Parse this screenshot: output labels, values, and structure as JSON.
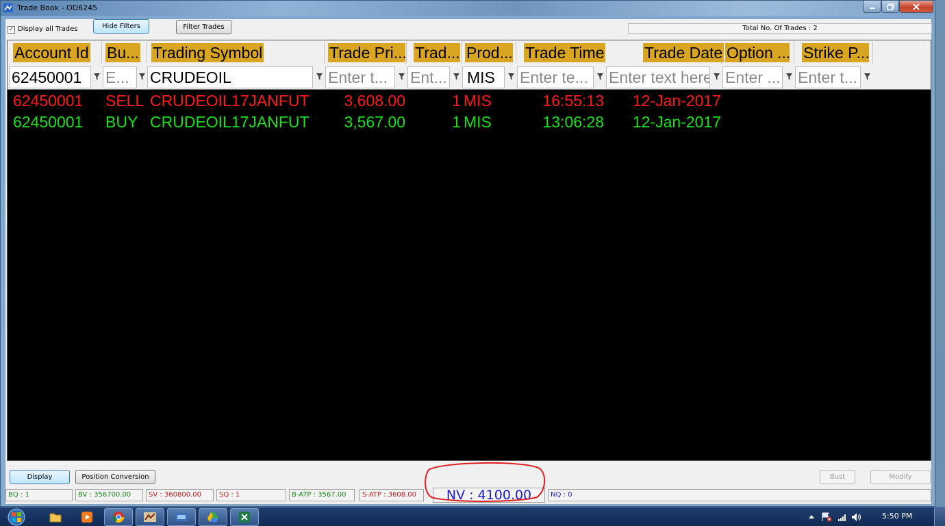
{
  "window": {
    "title": "Trade Book - OD6245"
  },
  "toolbar": {
    "display_all_label": "Display all Trades",
    "display_all_checked": true,
    "hide_filters_label": "Hide Filters",
    "filter_trades_label": "Filter Trades",
    "total_trades_label": "Total No. Of Trades : 2"
  },
  "grid": {
    "columns": [
      "Account Id",
      "Bu...",
      "Trading Symbol",
      "Trade Pri...",
      "Trad...",
      "Prod...",
      "Trade Time",
      "Trade Date",
      "Option ...",
      "Strike P..."
    ],
    "filters": [
      "62450001",
      "E...",
      "CRUDEOIL",
      "Enter t...",
      "Ent...",
      "MIS",
      "Enter te...",
      "Enter text here",
      "Enter ...",
      "Enter t..."
    ],
    "rows": [
      {
        "side": "sell",
        "account": "62450001",
        "buy_sell": "SELL",
        "symbol": "CRUDEOIL17JANFUT",
        "price": "3,608.00",
        "qty": "1",
        "product": "MIS",
        "time": "16:55:13",
        "date": "12-Jan-2017"
      },
      {
        "side": "buy",
        "account": "62450001",
        "buy_sell": "BUY",
        "symbol": "CRUDEOIL17JANFUT",
        "price": "3,567.00",
        "qty": "1",
        "product": "MIS",
        "time": "13:06:28",
        "date": "12-Jan-2017"
      }
    ]
  },
  "bottom": {
    "display_label": "Display",
    "position_conversion_label": "Position Conversion",
    "bust_label": "Bust",
    "modify_label": "Modify"
  },
  "status": {
    "bq": "BQ : 1",
    "bv": "BV : 356700.00",
    "sv": "SV : 360800.00",
    "sq": "SQ : 1",
    "b_atp": "B-ATP : 3567.00",
    "s_atp": "S-ATP : 3608.00",
    "nv": "NV : 4100.00",
    "nq": "NQ : 0"
  },
  "taskbar": {
    "clock": "5:50 PM",
    "apps": [
      "windows-explorer",
      "media-player",
      "chrome",
      "trading-terminal",
      "remote-app",
      "drive-app",
      "excel"
    ]
  },
  "colors": {
    "sell": "#ff1a1a",
    "buy": "#19e019",
    "header_bg": "#daa520",
    "highlight": "#e02020"
  }
}
